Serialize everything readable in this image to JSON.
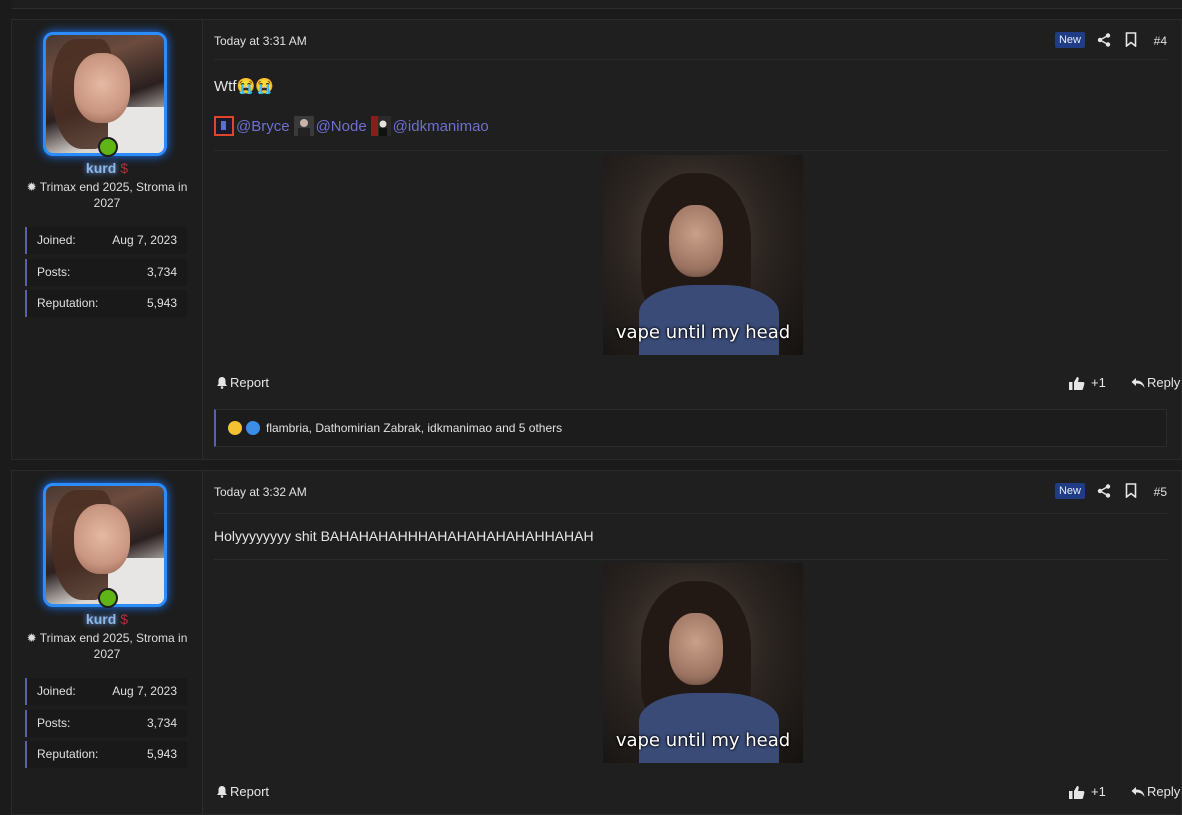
{
  "posts": [
    {
      "timestamp": "Today at 3:31 AM",
      "badge": "New",
      "number": "#4",
      "message": "Wtf😭😭",
      "mentions": [
        "@Bryce",
        "@Node",
        "@idkmanimao"
      ],
      "gif_caption": "vape until my head",
      "report_label": "Report",
      "like_count": "+1",
      "reply_label": "Reply",
      "reactions_text": "flambria, Dathomirian Zabrak, idkmanimao and 5 others",
      "user": {
        "name": "kurd",
        "name_suffix": "$",
        "title": "✹ Trimax end 2025, Stroma in 2027",
        "stats": [
          {
            "label": "Joined:",
            "value": "Aug 7, 2023"
          },
          {
            "label": "Posts:",
            "value": "3,734"
          },
          {
            "label": "Reputation:",
            "value": "5,943"
          }
        ]
      }
    },
    {
      "timestamp": "Today at 3:32 AM",
      "badge": "New",
      "number": "#5",
      "message": "Holyyyyyyyy shit BAHAHAHAHHHAHAHAHAHAHAHHAHAH",
      "gif_caption": "vape until my head",
      "report_label": "Report",
      "like_count": "+1",
      "reply_label": "Reply",
      "user": {
        "name": "kurd",
        "name_suffix": "$",
        "title": "✹ Trimax end 2025, Stroma in 2027",
        "stats": [
          {
            "label": "Joined:",
            "value": "Aug 7, 2023"
          },
          {
            "label": "Posts:",
            "value": "3,734"
          },
          {
            "label": "Reputation:",
            "value": "5,943"
          }
        ]
      }
    }
  ],
  "colors": {
    "accent": "#2b8cff",
    "mention": "#6e6fd0",
    "new_badge": "#1f3c84",
    "online": "#5fb514"
  }
}
